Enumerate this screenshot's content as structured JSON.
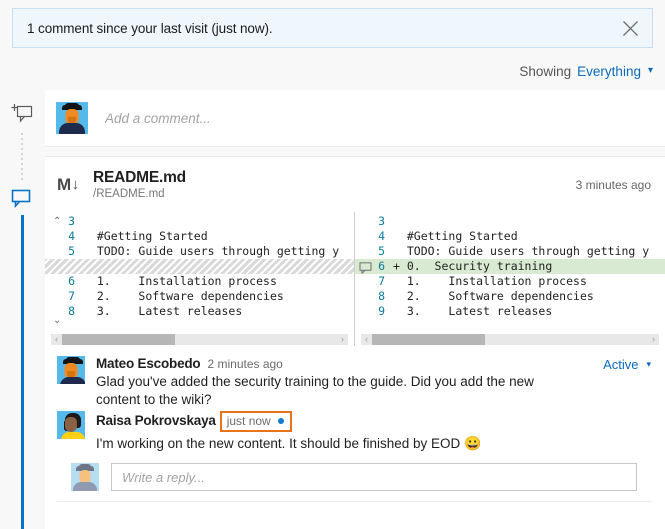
{
  "notification": {
    "text": "1 comment since your last visit (just now).",
    "close_icon": "close-icon",
    "bg_color": "#eff6fc",
    "border_color": "#c7e0f4"
  },
  "filter": {
    "label": "Showing",
    "value": "Everything",
    "caret": "⌄"
  },
  "rail": {
    "add_comment_icon": "add-comment-icon",
    "comment_icon": "comment-icon",
    "accent_color": "#0a72c4"
  },
  "composer": {
    "placeholder": "Add a comment...",
    "value": "",
    "avatar": "mateo-avatar"
  },
  "file": {
    "badge": "M",
    "badge_arrow": "↓",
    "name": "README.md",
    "path": "/README.md",
    "time": "3 minutes ago"
  },
  "diff": {
    "chevron_up": "⌃",
    "chevron_down": "⌄",
    "comment_marker_icon": "comment-marker-icon",
    "added_line_color": "#d9ead3",
    "left": {
      "lines": [
        {
          "num": "3",
          "mark": "",
          "code": "",
          "type": "context"
        },
        {
          "num": "4",
          "mark": "",
          "code": "#Getting Started",
          "type": "context"
        },
        {
          "num": "5",
          "mark": "",
          "code": "TODO: Guide users through getting y",
          "type": "context"
        },
        {
          "num": "",
          "mark": "",
          "code": "",
          "type": "hatch"
        },
        {
          "num": "6",
          "mark": "",
          "code": "1.    Installation process",
          "type": "context"
        },
        {
          "num": "7",
          "mark": "",
          "code": "2.    Software dependencies",
          "type": "context"
        },
        {
          "num": "8",
          "mark": "",
          "code": "3.    Latest releases",
          "type": "context"
        }
      ],
      "scroll_left_arrow": "‹",
      "scroll_right_arrow": "›"
    },
    "right": {
      "lines": [
        {
          "num": "3",
          "mark": "",
          "code": "",
          "type": "context"
        },
        {
          "num": "4",
          "mark": "",
          "code": "#Getting Started",
          "type": "context"
        },
        {
          "num": "5",
          "mark": "",
          "code": "TODO: Guide users through getting y",
          "type": "context"
        },
        {
          "num": "6",
          "mark": "+",
          "code": "0.  Security training",
          "type": "added"
        },
        {
          "num": "7",
          "mark": "",
          "code": "1.    Installation process",
          "type": "context"
        },
        {
          "num": "8",
          "mark": "",
          "code": "2.    Software dependencies",
          "type": "context"
        },
        {
          "num": "9",
          "mark": "",
          "code": "3.    Latest releases",
          "type": "context"
        }
      ],
      "scroll_left_arrow": "‹",
      "scroll_right_arrow": "›"
    }
  },
  "thread": {
    "status": {
      "label": "Active",
      "caret": "⌄"
    },
    "comments": [
      {
        "author": "Mateo Escobedo",
        "time": "2 minutes ago",
        "text": "Glad you've added the security training to the guide. Did you add the new content to the wiki?",
        "avatar": "mateo-avatar",
        "highlighted": false,
        "unread": false,
        "emoji": ""
      },
      {
        "author": "Raisa Pokrovskaya",
        "time": "just now",
        "text": "I'm working on the new content. It should be finished by EOD ",
        "avatar": "raisa-avatar",
        "highlighted": true,
        "highlight_color": "#e8731a",
        "unread": true,
        "unread_color": "#1178d4",
        "emoji": "😀"
      }
    ],
    "reply": {
      "placeholder": "Write a reply...",
      "value": "",
      "avatar": "faded-avatar"
    }
  }
}
